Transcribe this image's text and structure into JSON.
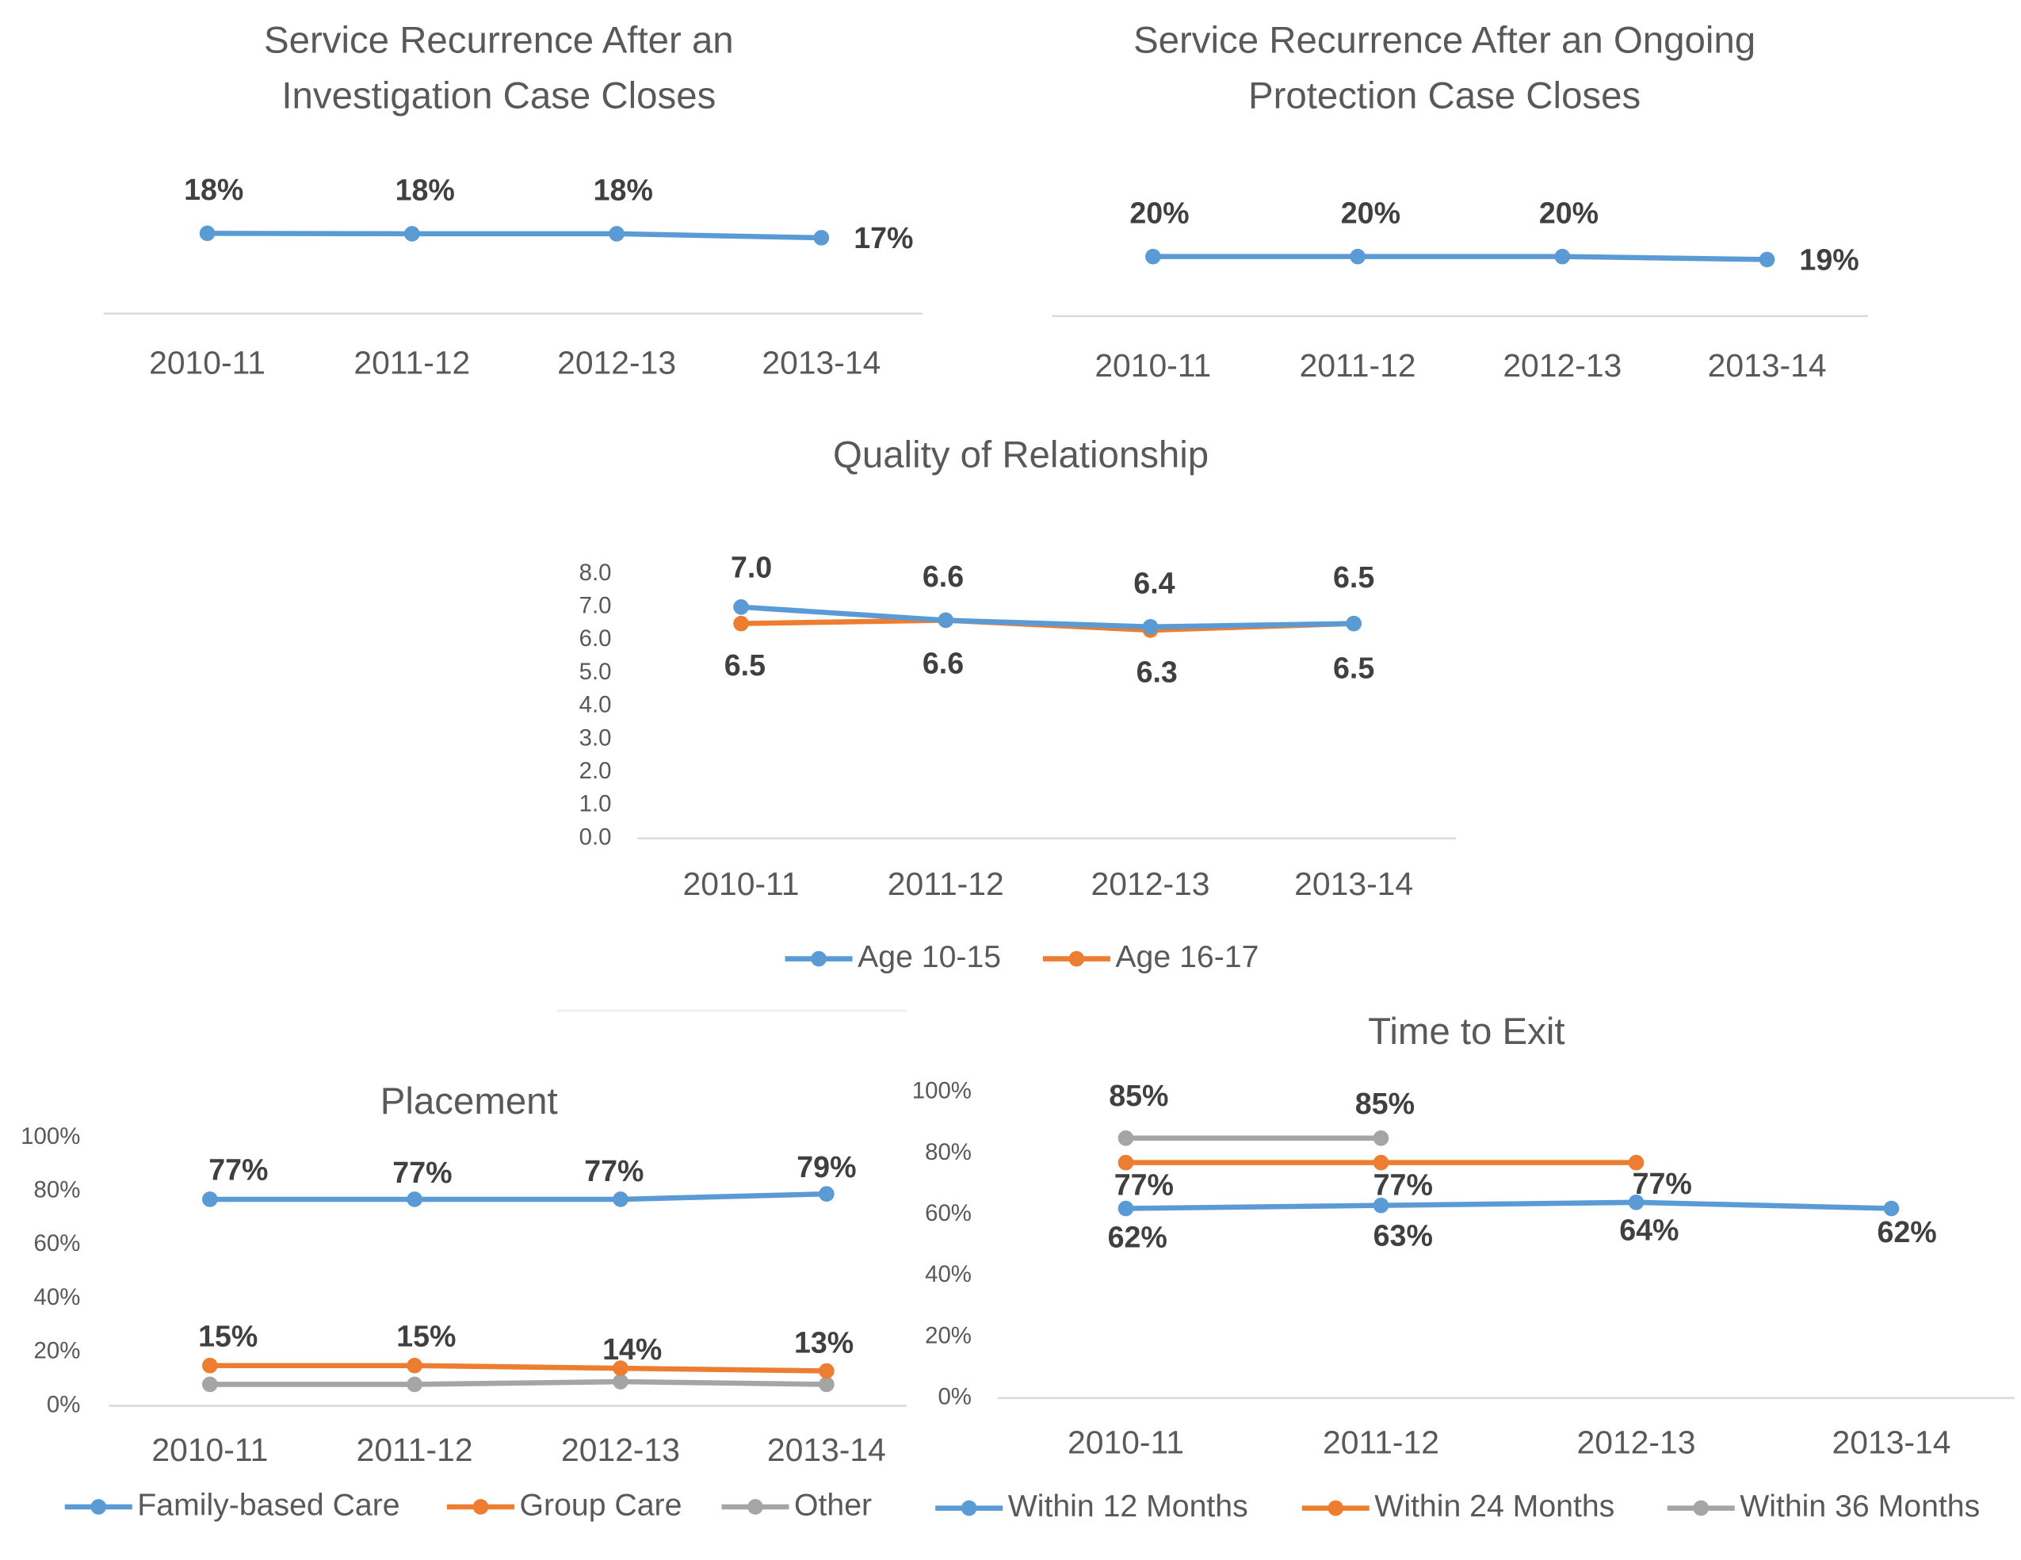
{
  "colors": {
    "blue": "#5B9BD5",
    "orange": "#ED7D31",
    "gray": "#A5A5A5",
    "axis": "#D9D9D9",
    "text": "#595959",
    "label": "#404040"
  },
  "chart_data": [
    {
      "type": "line",
      "title": [
        "Service Recurrence After an",
        "Investigation Case Closes"
      ],
      "categories": [
        "2010-11",
        "2011-12",
        "2012-13",
        "2013-14"
      ],
      "series": [
        {
          "color": "#5B9BD5",
          "values": [
            18,
            17.9,
            17.9,
            17
          ],
          "data_labels": [
            "18%",
            "18%",
            "18%",
            "17%"
          ]
        }
      ],
      "grid": false,
      "legend": "none",
      "y_axis_visible": false
    },
    {
      "type": "line",
      "title": [
        "Service Recurrence After an Ongoing",
        "Protection Case Closes"
      ],
      "categories": [
        "2010-11",
        "2011-12",
        "2012-13",
        "2013-14"
      ],
      "series": [
        {
          "color": "#5B9BD5",
          "values": [
            20,
            20,
            20,
            19
          ],
          "data_labels": [
            "20%",
            "20%",
            "20%",
            "19%"
          ]
        }
      ],
      "grid": false,
      "legend": "none",
      "y_axis_visible": false
    },
    {
      "type": "line",
      "title": [
        "Quality of Relationship"
      ],
      "categories": [
        "2010-11",
        "2011-12",
        "2012-13",
        "2013-14"
      ],
      "ylim": [
        0,
        8
      ],
      "yticks": [
        "0.0",
        "1.0",
        "2.0",
        "3.0",
        "4.0",
        "5.0",
        "6.0",
        "7.0",
        "8.0"
      ],
      "series": [
        {
          "name": "Age 10-15",
          "color": "#5B9BD5",
          "values": [
            7.0,
            6.6,
            6.4,
            6.5
          ],
          "data_labels": [
            "7.0",
            "6.6",
            "6.4",
            "6.5"
          ]
        },
        {
          "name": "Age 16-17",
          "color": "#ED7D31",
          "values": [
            6.5,
            6.6,
            6.3,
            6.5
          ],
          "data_labels": [
            "6.5",
            "6.6",
            "6.3",
            "6.5"
          ]
        }
      ],
      "grid": false,
      "legend": "bottom"
    },
    {
      "type": "line",
      "title": [
        "Placement"
      ],
      "categories": [
        "2010-11",
        "2011-12",
        "2012-13",
        "2013-14"
      ],
      "ylim": [
        0,
        100
      ],
      "yticks": [
        "0%",
        "20%",
        "40%",
        "60%",
        "80%",
        "100%"
      ],
      "series": [
        {
          "name": "Family-based Care",
          "color": "#5B9BD5",
          "values": [
            77,
            77,
            77,
            79
          ],
          "data_labels": [
            "77%",
            "77%",
            "77%",
            "79%"
          ]
        },
        {
          "name": "Group Care",
          "color": "#ED7D31",
          "values": [
            15,
            15,
            14,
            13
          ],
          "data_labels": [
            "15%",
            "15%",
            "14%",
            "13%"
          ]
        },
        {
          "name": "Other",
          "color": "#A5A5A5",
          "values": [
            8,
            8,
            9,
            8
          ],
          "data_labels": []
        }
      ],
      "grid": false,
      "legend": "bottom"
    },
    {
      "type": "line",
      "title": [
        "Time to Exit"
      ],
      "categories": [
        "2010-11",
        "2011-12",
        "2012-13",
        "2013-14"
      ],
      "ylim": [
        0,
        100
      ],
      "yticks": [
        "0%",
        "20%",
        "40%",
        "60%",
        "80%",
        "100%"
      ],
      "series": [
        {
          "name": "Within 12 Months",
          "color": "#5B9BD5",
          "values": [
            62,
            63,
            64,
            62
          ],
          "data_labels": [
            "62%",
            "63%",
            "64%",
            "62%"
          ]
        },
        {
          "name": "Within 24 Months",
          "color": "#ED7D31",
          "values": [
            77,
            77,
            77,
            null
          ],
          "data_labels": [
            "77%",
            "77%",
            "77%"
          ]
        },
        {
          "name": "Within 36 Months",
          "color": "#A5A5A5",
          "values": [
            85,
            85,
            null,
            null
          ],
          "data_labels": [
            "85%",
            "85%"
          ]
        }
      ],
      "grid": false,
      "legend": "bottom"
    }
  ]
}
